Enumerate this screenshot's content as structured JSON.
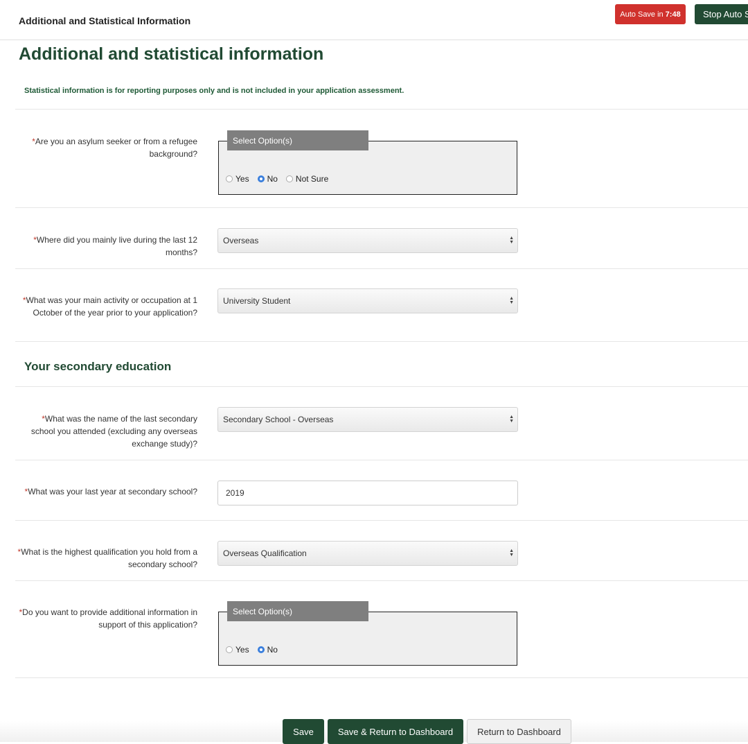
{
  "header": {
    "title": "Additional and Statistical Information",
    "autosave_prefix": "Auto Save in",
    "autosave_time": "7:48",
    "stop_autosave_label": "Stop Auto S",
    "autosave_color": "#d0312d",
    "brand_color": "#214a33"
  },
  "page": {
    "heading": "Additional and statistical information",
    "note": "Statistical information is for reporting purposes only and is not included in your application assessment."
  },
  "questions": {
    "asylum": {
      "label": "Are you an asylum seeker or from a refugee background?",
      "legend": "Select Option(s)",
      "options": [
        "Yes",
        "No",
        "Not Sure"
      ],
      "selected": "No"
    },
    "residence": {
      "label": "Where did you mainly live during the last 12 months?",
      "value": "Overseas"
    },
    "occupation": {
      "label": "What was your main activity or occupation at 1 October of the year prior to your application?",
      "value": "University Student"
    },
    "secondary_heading": "Your secondary education",
    "school": {
      "label": "What was the name of the last secondary school you attended (excluding any overseas exchange study)?",
      "value": "Secondary School - Overseas"
    },
    "last_year": {
      "label": "What was your last year at secondary school?",
      "value": "2019"
    },
    "qualification": {
      "label": "What is the highest qualification you hold from a secondary school?",
      "value": "Overseas Qualification"
    },
    "additional": {
      "label": "Do you want to provide additional information in support of this application?",
      "legend": "Select Option(s)",
      "options": [
        "Yes",
        "No"
      ],
      "selected": "No"
    }
  },
  "footer": {
    "save": "Save",
    "save_return": "Save & Return to Dashboard",
    "return": "Return to Dashboard"
  }
}
